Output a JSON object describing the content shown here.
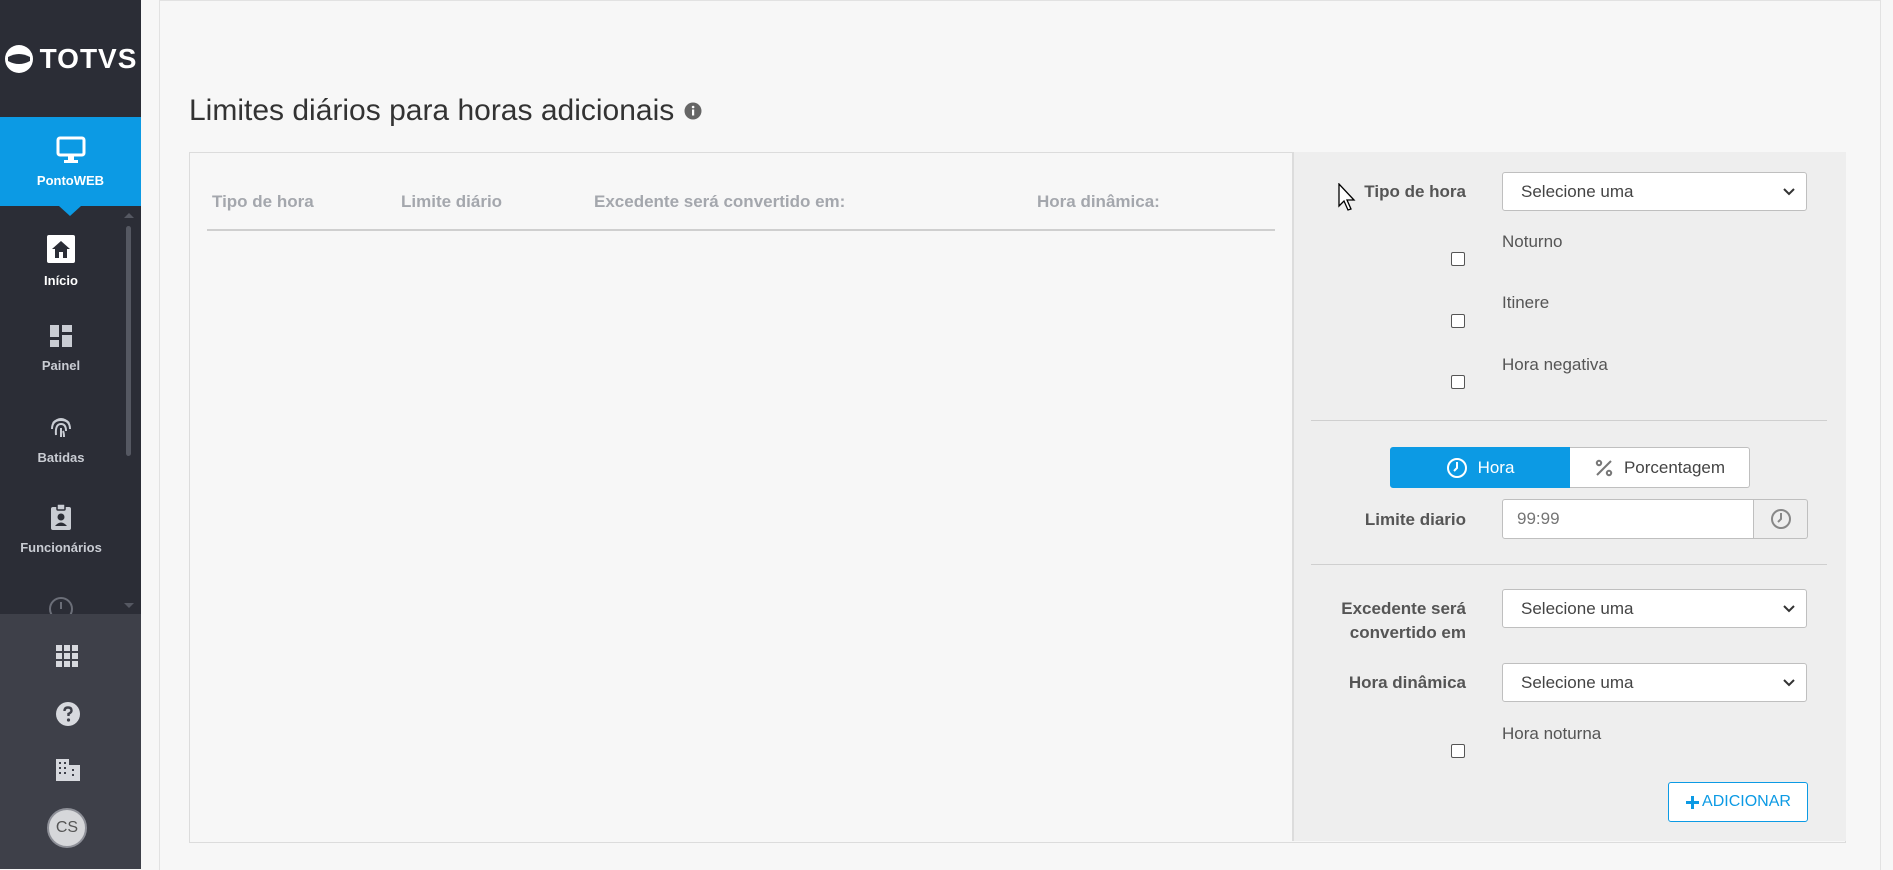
{
  "brand": {
    "name": "TOTVS",
    "app": "PontoWEB",
    "accent": "#0c9ae4",
    "sidebar_bg": "#2b2d36"
  },
  "sidebar": {
    "items": [
      {
        "label": "Início",
        "icon": "home-icon",
        "active": true
      },
      {
        "label": "Painel",
        "icon": "dashboard-icon",
        "active": false
      },
      {
        "label": "Batidas",
        "icon": "fingerprint-icon",
        "active": false
      },
      {
        "label": "Funcionários",
        "icon": "badge-icon",
        "active": false
      }
    ],
    "bottom": {
      "apps_icon": "apps-grid-icon",
      "help_icon": "help-icon",
      "company_icon": "building-icon",
      "avatar": "CS"
    }
  },
  "page": {
    "title": "Limites diários para horas adicionais",
    "info_icon": "info-icon"
  },
  "table": {
    "headers": [
      "Tipo de hora",
      "Limite diário",
      "Excedente será convertido em:",
      "Hora dinâmica:"
    ]
  },
  "form": {
    "tipo_label": "Tipo de hora",
    "tipo_value": "Selecione uma",
    "checks": [
      "Noturno",
      "Itinere",
      "Hora negativa"
    ],
    "mode_hora": "Hora",
    "mode_pct": "Porcentagem",
    "limite_label": "Limite diario",
    "limite_placeholder": "99:99",
    "excedente_label_1": "Excedente será",
    "excedente_label_2": "convertido em",
    "excedente_value": "Selecione uma",
    "dinamica_label": "Hora dinâmica",
    "dinamica_value": "Selecione uma",
    "noturna_check": "Hora noturna",
    "add_label": "ADICIONAR"
  }
}
